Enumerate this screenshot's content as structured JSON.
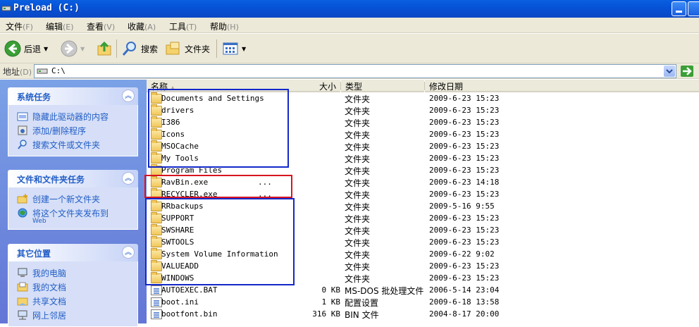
{
  "window": {
    "title": "Preload (C:)"
  },
  "colors": {
    "title_bar": "#0653d8",
    "highlight_blue": "#1428c8",
    "highlight_red": "#d81420",
    "task_link": "#215dc6"
  },
  "menu": [
    {
      "label": "文件",
      "key": "(F)"
    },
    {
      "label": "编辑",
      "key": "(E)"
    },
    {
      "label": "查看",
      "key": "(V)"
    },
    {
      "label": "收藏",
      "key": "(A)"
    },
    {
      "label": "工具",
      "key": "(T)"
    },
    {
      "label": "帮助",
      "key": "(H)"
    }
  ],
  "toolbar": {
    "back_label": "后退",
    "search_label": "搜索",
    "folders_label": "文件夹",
    "icons": {
      "back": "back-arrow-icon",
      "forward": "forward-arrow-icon",
      "up": "folder-up-icon",
      "search": "magnifier-icon",
      "folders": "folders-icon",
      "views": "views-icon"
    }
  },
  "address": {
    "label": "地址",
    "key": "(D)",
    "value": "C:\\"
  },
  "left_pane": {
    "panels": [
      {
        "title": "系统任务",
        "tasks": [
          {
            "label": "隐藏此驱动器的内容",
            "icon": "drive-contents-icon"
          },
          {
            "label": "添加/删除程序",
            "icon": "add-remove-programs-icon"
          },
          {
            "label": "搜索文件或文件夹",
            "icon": "search-files-icon"
          }
        ]
      },
      {
        "title": "文件和文件夹任务",
        "tasks": [
          {
            "label": "创建一个新文件夹",
            "icon": "new-folder-icon"
          },
          {
            "label": "将这个文件夹发布到",
            "sub": "Web",
            "icon": "publish-web-icon"
          }
        ]
      },
      {
        "title": "其它位置",
        "tasks": [
          {
            "label": "我的电脑",
            "icon": "my-computer-icon"
          },
          {
            "label": "我的文档",
            "icon": "my-documents-icon"
          },
          {
            "label": "共享文档",
            "icon": "shared-documents-icon"
          },
          {
            "label": "网上邻居",
            "icon": "network-places-icon"
          }
        ]
      }
    ]
  },
  "columns": {
    "name": "名称",
    "size": "大小",
    "type": "类型",
    "modified": "修改日期"
  },
  "files": [
    {
      "name": "Documents and Settings",
      "size": "",
      "type": "文件夹",
      "modified": "2009-6-23 15:23",
      "kind": "folder"
    },
    {
      "name": "drivers",
      "size": "",
      "type": "文件夹",
      "modified": "2009-6-23 15:23",
      "kind": "folder"
    },
    {
      "name": "I386",
      "size": "",
      "type": "文件夹",
      "modified": "2009-6-23 15:23",
      "kind": "folder"
    },
    {
      "name": "Icons",
      "size": "",
      "type": "文件夹",
      "modified": "2009-6-23 15:23",
      "kind": "folder"
    },
    {
      "name": "MSOCache",
      "size": "",
      "type": "文件夹",
      "modified": "2009-6-23 15:23",
      "kind": "folder"
    },
    {
      "name": "My Tools",
      "size": "",
      "type": "文件夹",
      "modified": "2009-6-23 15:23",
      "kind": "folder"
    },
    {
      "name": "Program Files",
      "size": "",
      "type": "文件夹",
      "modified": "2009-6-23 15:23",
      "kind": "folder"
    },
    {
      "name": "RavBin.exe",
      "size": "",
      "type": "文件夹",
      "modified": "2009-6-23 14:18",
      "kind": "folder",
      "extra": "..."
    },
    {
      "name": "RECYCLER.exe",
      "size": "",
      "type": "文件夹",
      "modified": "2009-6-23 15:23",
      "kind": "folder",
      "extra": "..."
    },
    {
      "name": "RRbackups",
      "size": "",
      "type": "文件夹",
      "modified": "2009-5-16 9:55",
      "kind": "folder"
    },
    {
      "name": "SUPPORT",
      "size": "",
      "type": "文件夹",
      "modified": "2009-6-23 15:23",
      "kind": "folder"
    },
    {
      "name": "SWSHARE",
      "size": "",
      "type": "文件夹",
      "modified": "2009-6-23 15:23",
      "kind": "folder"
    },
    {
      "name": "SWTOOLS",
      "size": "",
      "type": "文件夹",
      "modified": "2009-6-23 15:23",
      "kind": "folder"
    },
    {
      "name": "System Volume Information",
      "size": "",
      "type": "文件夹",
      "modified": "2009-6-22 9:02",
      "kind": "folder"
    },
    {
      "name": "VALUEADD",
      "size": "",
      "type": "文件夹",
      "modified": "2009-6-23 15:23",
      "kind": "folder"
    },
    {
      "name": "WINDOWS",
      "size": "",
      "type": "文件夹",
      "modified": "2009-6-23 15:23",
      "kind": "folder"
    },
    {
      "name": "AUTOEXEC.BAT",
      "size": "0 KB",
      "type": "MS-DOS 批处理文件",
      "modified": "2006-5-14 23:04",
      "kind": "file"
    },
    {
      "name": "boot.ini",
      "size": "1 KB",
      "type": "配置设置",
      "modified": "2009-6-18 13:58",
      "kind": "file"
    },
    {
      "name": "bootfont.bin",
      "size": "316 KB",
      "type": "BIN 文件",
      "modified": "2004-8-17 20:00",
      "kind": "file"
    }
  ]
}
